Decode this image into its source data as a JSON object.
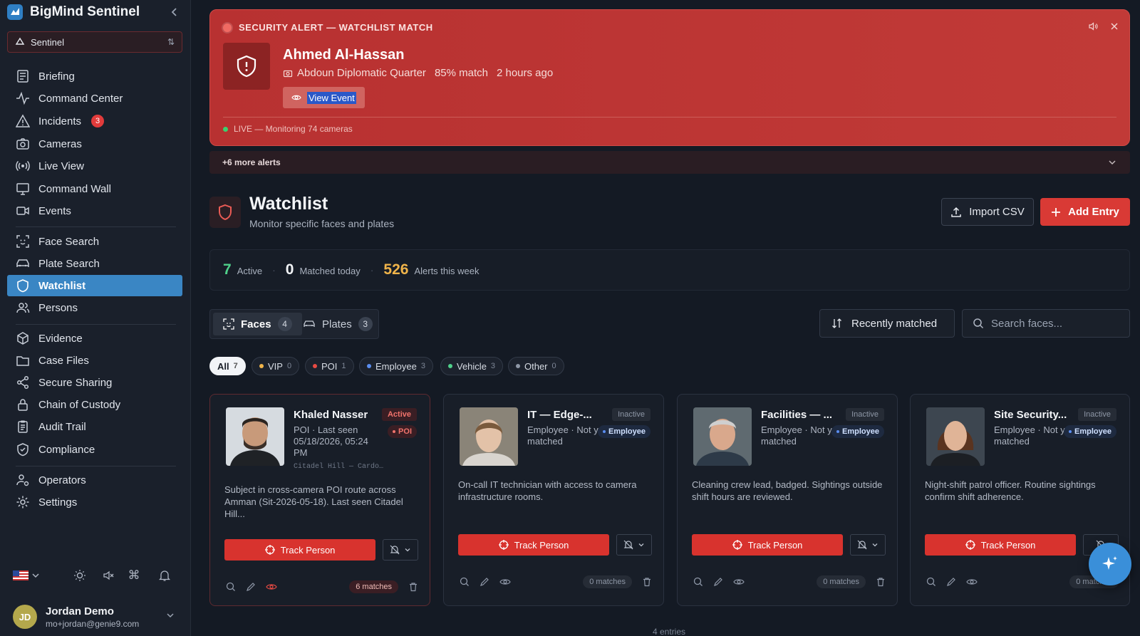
{
  "app": {
    "name": "BigMind Sentinel",
    "workspace": "Sentinel"
  },
  "sidebar": {
    "group1": [
      {
        "label": "Briefing",
        "icon": "briefing-icon"
      },
      {
        "label": "Command Center",
        "icon": "activity-icon"
      },
      {
        "label": "Incidents",
        "icon": "warning-icon",
        "badge": "3"
      },
      {
        "label": "Cameras",
        "icon": "camera-icon"
      },
      {
        "label": "Live View",
        "icon": "broadcast-icon"
      },
      {
        "label": "Command Wall",
        "icon": "monitor-icon"
      },
      {
        "label": "Events",
        "icon": "video-icon"
      }
    ],
    "group2": [
      {
        "label": "Face Search",
        "icon": "face-scan-icon"
      },
      {
        "label": "Plate Search",
        "icon": "car-icon"
      },
      {
        "label": "Watchlist",
        "icon": "shield-icon",
        "active": true
      },
      {
        "label": "Persons",
        "icon": "users-icon"
      }
    ],
    "group3": [
      {
        "label": "Evidence",
        "icon": "box-icon"
      },
      {
        "label": "Case Files",
        "icon": "folder-icon"
      },
      {
        "label": "Secure Sharing",
        "icon": "share-icon"
      },
      {
        "label": "Chain of Custody",
        "icon": "lock-icon"
      },
      {
        "label": "Audit Trail",
        "icon": "clipboard-icon"
      },
      {
        "label": "Compliance",
        "icon": "shield-check-icon"
      }
    ],
    "group4": [
      {
        "label": "Operators",
        "icon": "user-cog-icon"
      },
      {
        "label": "Settings",
        "icon": "gear-icon"
      }
    ],
    "user": {
      "initials": "JD",
      "name": "Jordan Demo",
      "email": "mo+jordan@genie9.com"
    }
  },
  "alert": {
    "heading": "SECURITY ALERT — WATCHLIST MATCH",
    "name": "Ahmed Al-Hassan",
    "location": "Abdoun Diplomatic Quarter",
    "match": "85% match",
    "time": "2 hours ago",
    "view_label": "View Event",
    "live_text": "LIVE — Monitoring 74 cameras",
    "more_label": "+6 more alerts"
  },
  "header": {
    "title": "Watchlist",
    "subtitle": "Monitor specific faces and plates",
    "import_label": "Import CSV",
    "add_label": "Add Entry"
  },
  "stats": [
    {
      "value": "7",
      "label": "Active",
      "color": "#4fd08a"
    },
    {
      "value": "0",
      "label": "Matched today",
      "color": "#f2f4f7"
    },
    {
      "value": "526",
      "label": "Alerts this week",
      "color": "#f0b44a"
    }
  ],
  "tabs": [
    {
      "label": "Faces",
      "count": "4",
      "icon": "face-scan-icon"
    },
    {
      "label": "Plates",
      "count": "3",
      "icon": "car-icon"
    }
  ],
  "sort_label": "Recently matched",
  "search_placeholder": "Search faces...",
  "filters": [
    {
      "label": "All",
      "count": "7"
    },
    {
      "label": "VIP",
      "count": "0",
      "color": "#f0b44a"
    },
    {
      "label": "POI",
      "count": "1",
      "color": "#e84a43"
    },
    {
      "label": "Employee",
      "count": "3",
      "color": "#5b8ef0"
    },
    {
      "label": "Vehicle",
      "count": "3",
      "color": "#4fd08a"
    },
    {
      "label": "Other",
      "count": "0",
      "color": "#8e97a6"
    }
  ],
  "cards": [
    {
      "name": "Khaled Nasser",
      "status": "Active",
      "type": "POI",
      "meta": "POI · Last seen 05/18/2026, 05:24 PM",
      "location": "Citadel Hill — Cardo…",
      "desc": "Subject in cross-camera POI route across Amman (Sit-2026-05-18). Last seen Citadel Hill...",
      "track_label": "Track Person",
      "matches": "6 matches"
    },
    {
      "name": "IT — Edge-...",
      "status": "Inactive",
      "type": "Employee",
      "meta": "Employee · Not yet matched",
      "location": "",
      "desc": "On-call IT technician with access to camera infrastructure rooms.",
      "track_label": "Track Person",
      "matches": "0 matches"
    },
    {
      "name": "Facilities — ...",
      "status": "Inactive",
      "type": "Employee",
      "meta": "Employee · Not yet matched",
      "location": "",
      "desc": "Cleaning crew lead, badged. Sightings outside shift hours are reviewed.",
      "track_label": "Track Person",
      "matches": "0 matches"
    },
    {
      "name": "Site Security...",
      "status": "Inactive",
      "type": "Employee",
      "meta": "Employee · Not yet matched",
      "location": "",
      "desc": "Night-shift patrol officer. Routine sightings confirm shift adherence.",
      "track_label": "Track Person",
      "matches": "0 matches"
    }
  ],
  "entries_label": "4 entries"
}
